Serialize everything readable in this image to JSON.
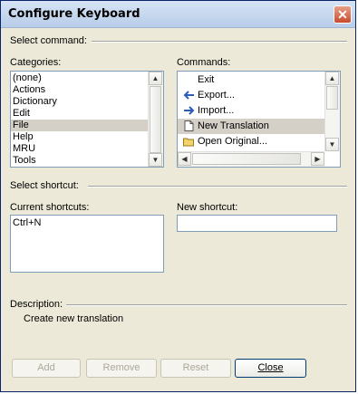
{
  "window": {
    "title": "Configure Keyboard",
    "close_glyph": "✕"
  },
  "select_command": {
    "label": "Select command:"
  },
  "categories": {
    "label": "Categories:",
    "items": [
      "(none)",
      "Actions",
      "Dictionary",
      "Edit",
      "File",
      "Help",
      "MRU",
      "Tools"
    ],
    "selected": "File"
  },
  "commands": {
    "label": "Commands:",
    "items": [
      {
        "label": "Exit",
        "icon": "none"
      },
      {
        "label": "Export...",
        "icon": "export-arrow-icon"
      },
      {
        "label": "Import...",
        "icon": "import-arrow-icon"
      },
      {
        "label": "New Translation",
        "icon": "new-document-icon"
      },
      {
        "label": "Open Original...",
        "icon": "open-folder-icon"
      }
    ],
    "selected": "New Translation"
  },
  "select_shortcut": {
    "label": "Select shortcut:"
  },
  "current_shortcuts": {
    "label": "Current shortcuts:",
    "items": [
      "Ctrl+N"
    ]
  },
  "new_shortcut": {
    "label": "New shortcut:",
    "value": ""
  },
  "description": {
    "label": "Description:",
    "text": "Create new translation"
  },
  "buttons": {
    "add": "Add",
    "remove": "Remove",
    "reset": "Reset",
    "close": "Close"
  }
}
